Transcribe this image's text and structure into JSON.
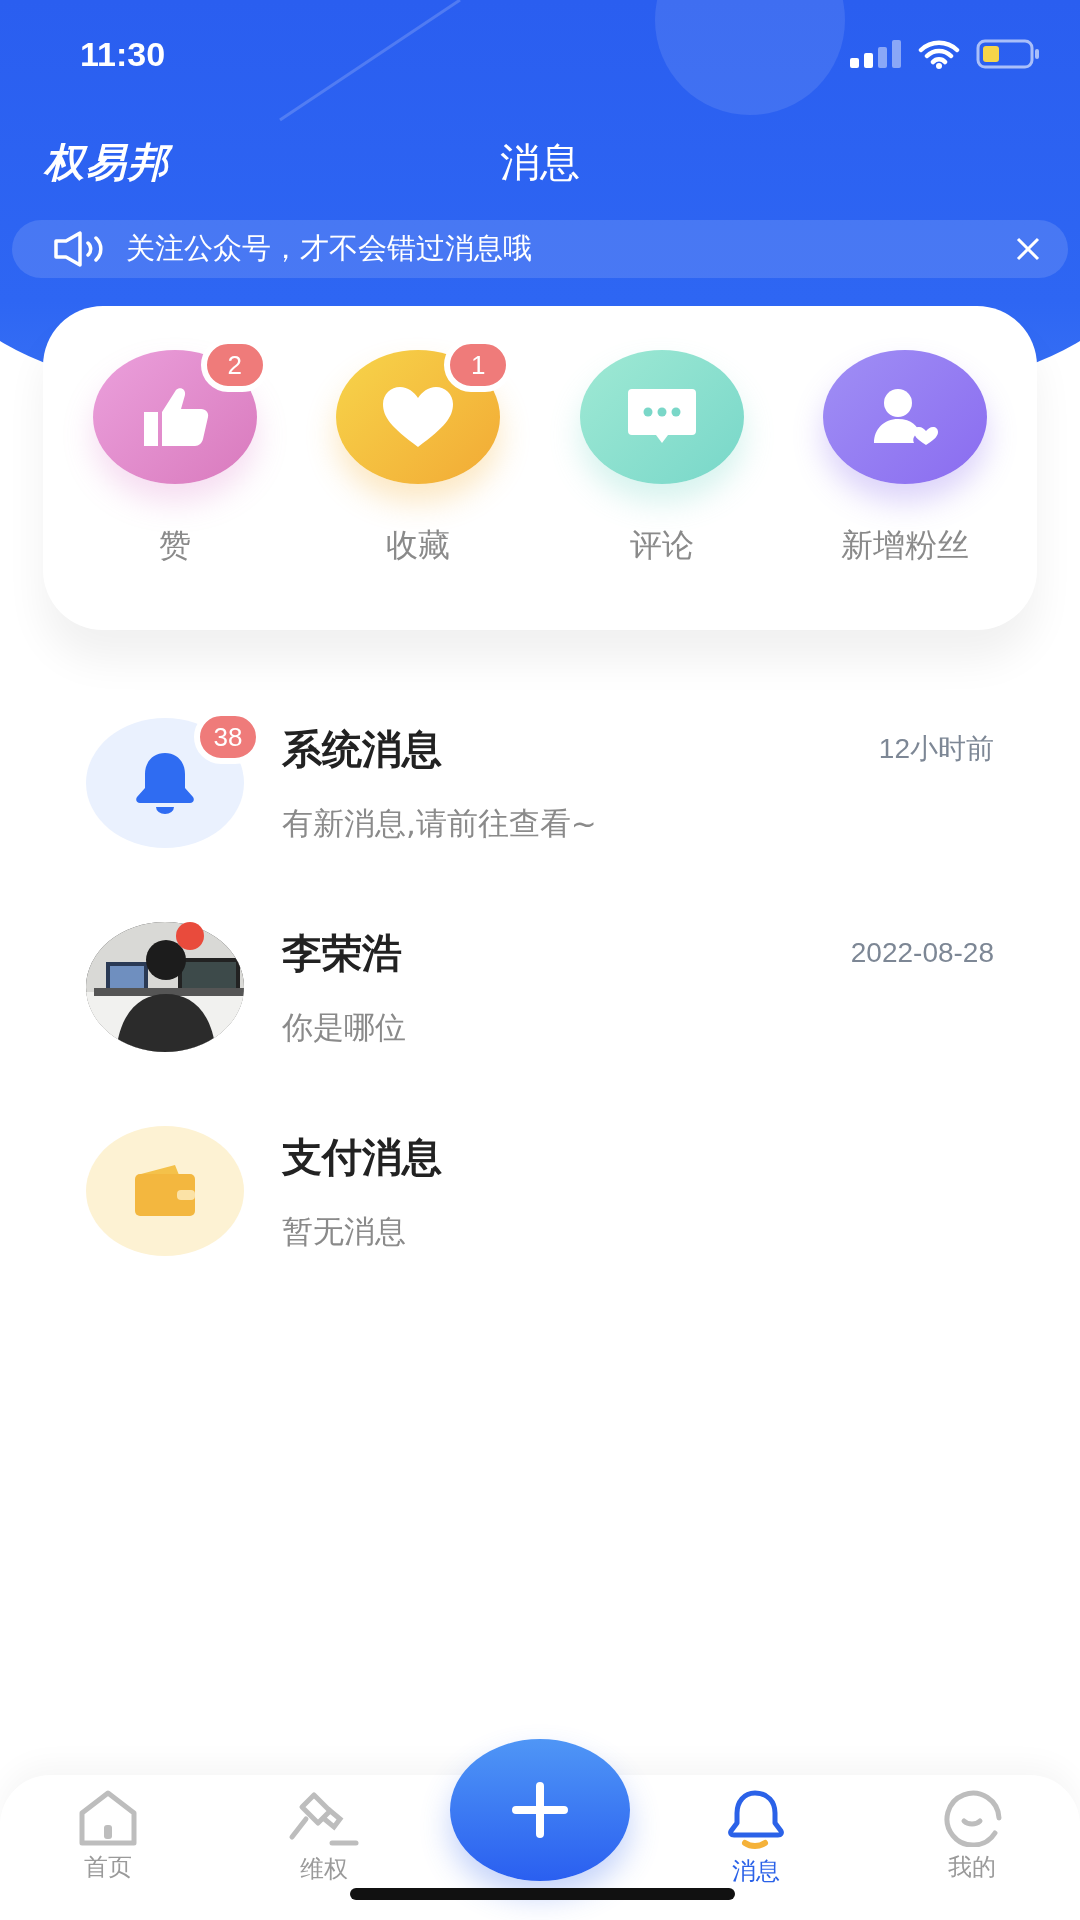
{
  "status_bar": {
    "time": "11:30"
  },
  "header": {
    "logo": "权易邦",
    "title": "消息"
  },
  "notice": {
    "text": "关注公众号，才不会错过消息哦"
  },
  "categories": [
    {
      "kind": "like",
      "label": "赞",
      "badge": "2"
    },
    {
      "kind": "favorite",
      "label": "收藏",
      "badge": "1"
    },
    {
      "kind": "comment",
      "label": "评论"
    },
    {
      "kind": "follower",
      "label": "新增粉丝"
    }
  ],
  "messages": [
    {
      "kind": "system",
      "title": "系统消息",
      "preview": "有新消息,请前往查看~",
      "time": "12小时前",
      "badge": "38",
      "dot": false
    },
    {
      "kind": "contact",
      "title": "李荣浩",
      "preview": "你是哪位",
      "time": "2022-08-28",
      "dot": true
    },
    {
      "kind": "payment",
      "title": "支付消息",
      "preview": "暂无消息",
      "dot": false
    }
  ],
  "nav": [
    {
      "kind": "home",
      "label": "首页",
      "selected": false
    },
    {
      "kind": "rights",
      "label": "维权",
      "selected": false
    },
    {
      "kind": "add"
    },
    {
      "kind": "messages",
      "label": "消息",
      "selected": true
    },
    {
      "kind": "profile",
      "label": "我的",
      "selected": false
    }
  ]
}
